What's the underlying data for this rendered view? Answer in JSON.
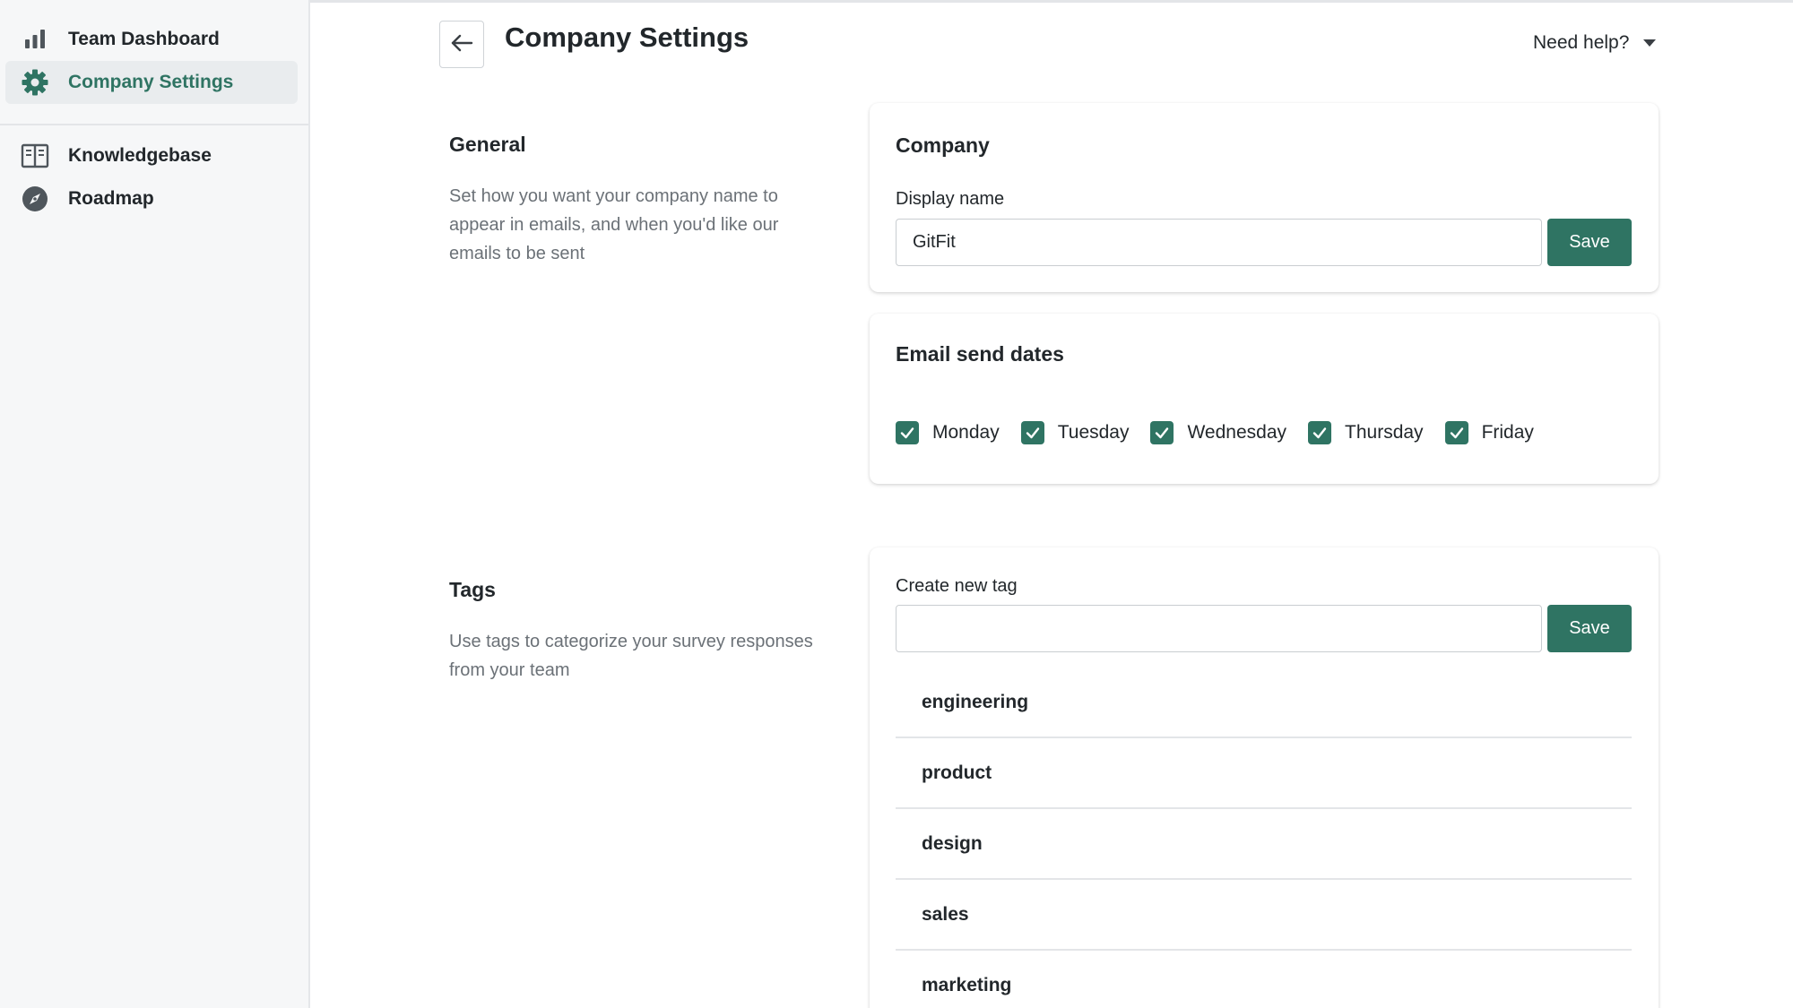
{
  "sidebar": {
    "items": [
      {
        "label": "Team Dashboard",
        "icon": "bar-chart-icon"
      },
      {
        "label": "Company Settings",
        "icon": "gear-icon",
        "active": true
      },
      {
        "label": "Knowledgebase",
        "icon": "book-icon"
      },
      {
        "label": "Roadmap",
        "icon": "compass-icon"
      }
    ]
  },
  "header": {
    "title": "Company Settings",
    "back_icon": "arrow-left-icon",
    "help_label": "Need help?"
  },
  "general": {
    "title": "General",
    "description": "Set how you want your company name to appear in emails, and when you'd like our emails to be sent"
  },
  "company_card": {
    "title": "Company",
    "display_name_label": "Display name",
    "display_name_value": "GitFit",
    "save_label": "Save"
  },
  "email_card": {
    "title": "Email send dates",
    "days": [
      {
        "label": "Monday",
        "checked": true
      },
      {
        "label": "Tuesday",
        "checked": true
      },
      {
        "label": "Wednesday",
        "checked": true
      },
      {
        "label": "Thursday",
        "checked": true
      },
      {
        "label": "Friday",
        "checked": true
      }
    ]
  },
  "tags_section": {
    "title": "Tags",
    "description": "Use tags to categorize your survey responses from your team"
  },
  "tags_card": {
    "new_tag_label": "Create new tag",
    "new_tag_value": "",
    "save_label": "Save",
    "tags": [
      "engineering",
      "product",
      "design",
      "sales",
      "marketing"
    ]
  },
  "colors": {
    "accent": "#2f7463",
    "sidebar_bg": "#f6f7f8",
    "muted_text": "#6b7177"
  }
}
